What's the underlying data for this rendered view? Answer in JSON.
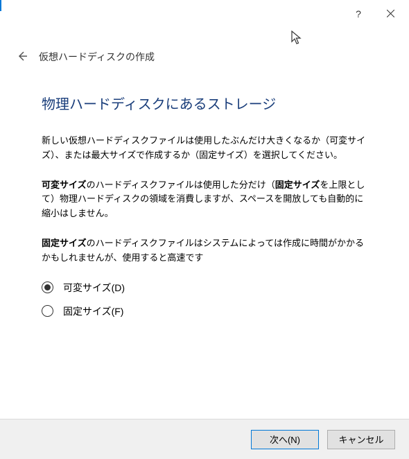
{
  "titlebar": {
    "help": "?",
    "close": "✕"
  },
  "header": {
    "breadcrumb": "仮想ハードディスクの作成"
  },
  "page": {
    "heading": "物理ハードディスクにあるストレージ",
    "intro": "新しい仮想ハードディスクファイルは使用したぶんだけ大きくなるか（可変サイズ）、または最大サイズで作成するか（固定サイズ）を選択してください。",
    "para_dynamic_prefix": "可変サイズ",
    "para_dynamic_mid": "のハードディスクファイルは使用した分だけ（",
    "para_dynamic_bold2": "固定サイズ",
    "para_dynamic_suffix": "を上限として）物理ハードディスクの領域を消費しますが、スペースを開放しても自動的に縮小はしません。",
    "para_fixed_prefix": "固定サイズ",
    "para_fixed_suffix": "のハードディスクファイルはシステムによっては作成に時間がかかるかもしれませんが、使用すると高速です"
  },
  "options": {
    "dynamic": "可変サイズ(D)",
    "fixed": "固定サイズ(F)"
  },
  "buttons": {
    "next": "次へ(N)",
    "cancel": "キャンセル"
  }
}
